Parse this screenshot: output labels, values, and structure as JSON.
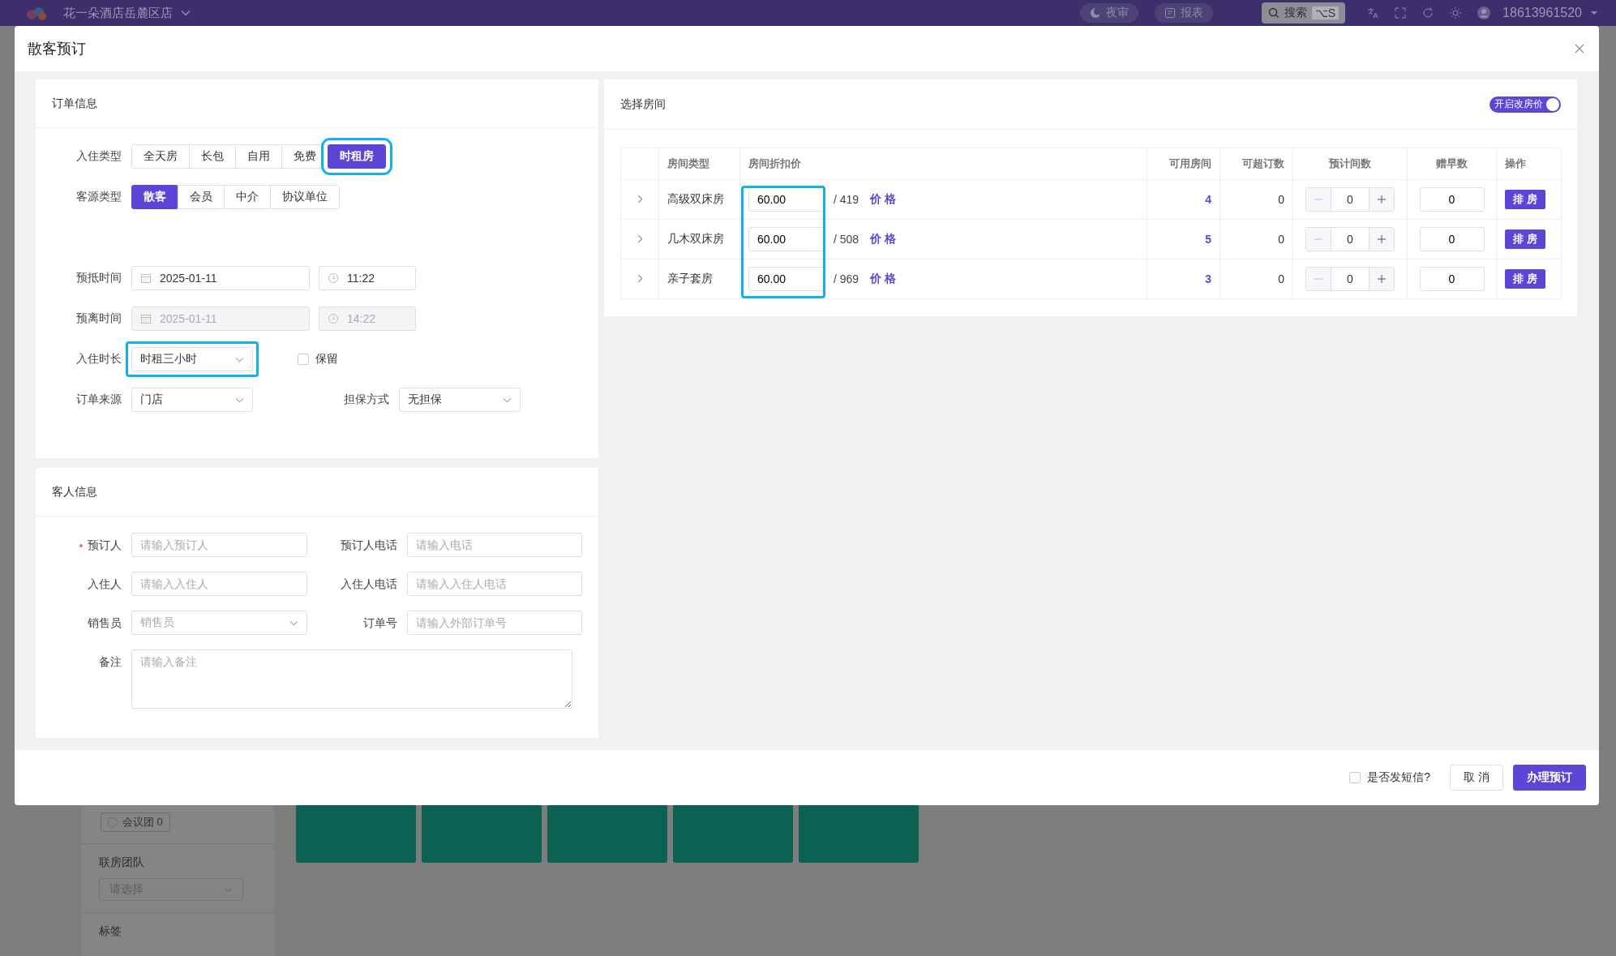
{
  "app_bar": {
    "hotel": "花一朵酒店岳麓区店",
    "buttons": [
      {
        "label": "夜审",
        "kind": "moon"
      },
      {
        "label": "报表",
        "kind": "report"
      }
    ],
    "search": {
      "label": "搜索",
      "shortcut": "⌥S"
    },
    "user": "18613961520"
  },
  "dialog": {
    "title": "散客预订"
  },
  "order_info": {
    "title": "订单信息",
    "checkin_type": {
      "label": "入住类型",
      "options": [
        {
          "label": "全天房",
          "selected": false,
          "highlighted": false
        },
        {
          "label": "长包",
          "selected": false,
          "highlighted": false
        },
        {
          "label": "自用",
          "selected": false,
          "highlighted": false
        },
        {
          "label": "免费",
          "selected": false,
          "highlighted": false
        },
        {
          "label": "时租房",
          "selected": true,
          "highlighted": true
        }
      ]
    },
    "guest_source": {
      "label": "客源类型",
      "options": [
        {
          "label": "散客",
          "selected": true,
          "highlighted": false
        },
        {
          "label": "会员",
          "selected": false,
          "highlighted": false
        },
        {
          "label": "中介",
          "selected": false,
          "highlighted": false
        },
        {
          "label": "协议单位",
          "selected": false,
          "highlighted": false
        }
      ]
    },
    "arrival": {
      "label": "预抵时间",
      "date": "2025-01-11",
      "time": "11:22",
      "disabled": false
    },
    "departure": {
      "label": "预离时间",
      "date": "2025-01-11",
      "time": "14:22",
      "disabled": true
    },
    "duration": {
      "label": "入住时长",
      "value": "时租三小时",
      "highlighted": true
    },
    "keep": {
      "label": "保留",
      "checked": false
    },
    "order_source": {
      "label": "订单来源",
      "value": "门店"
    },
    "guarantee": {
      "label": "担保方式",
      "value": "无担保"
    }
  },
  "guest_info": {
    "title": "客人信息",
    "fields": [
      {
        "label": "预订人",
        "placeholder": "请输入预订人",
        "required": true,
        "kind": "input"
      },
      {
        "label": "预订人电话",
        "placeholder": "请输入电话",
        "required": false,
        "kind": "input"
      },
      {
        "label": "入住人",
        "placeholder": "请输入入住人",
        "required": false,
        "kind": "input"
      },
      {
        "label": "入住人电话",
        "placeholder": "请输入入住人电话",
        "required": false,
        "kind": "input"
      },
      {
        "label": "销售员",
        "placeholder": "销售员",
        "required": false,
        "kind": "select"
      },
      {
        "label": "订单号",
        "placeholder": "请输入外部订单号",
        "required": false,
        "kind": "input"
      },
      {
        "label": "备注",
        "placeholder": "请输入备注",
        "required": false,
        "kind": "textarea"
      }
    ]
  },
  "rooms": {
    "title": "选择房间",
    "price_toggle": {
      "label": "开启改房价",
      "on": true
    },
    "price_highlighted": true,
    "columns": [
      "房间类型",
      "房间折扣价",
      "可用房间",
      "可超订数",
      "预计间数",
      "赠早数",
      "操作"
    ],
    "rows": [
      {
        "type": "高级双床房",
        "price": "60.00",
        "list_price": "/ 419",
        "link": "价 格",
        "available": "4",
        "overbook": "0",
        "count": "0",
        "breakfast": "0",
        "action": "排 房"
      },
      {
        "type": "几木双床房",
        "price": "60.00",
        "list_price": "/ 508",
        "link": "价 格",
        "available": "5",
        "overbook": "0",
        "count": "0",
        "breakfast": "0",
        "action": "排 房"
      },
      {
        "type": "亲子套房",
        "price": "60.00",
        "list_price": "/ 969",
        "link": "价 格",
        "available": "3",
        "overbook": "0",
        "count": "0",
        "breakfast": "0",
        "action": "排 房"
      }
    ]
  },
  "footer": {
    "sms": {
      "label": "是否发短信?",
      "checked": false
    },
    "buttons": [
      {
        "label": "取 消",
        "kind": "secondary"
      },
      {
        "label": "办理预订",
        "kind": "primary"
      }
    ]
  },
  "background": {
    "chip": "会议团 0",
    "group_label": "联房团队",
    "group_placeholder": "请选择",
    "tags_label": "标签"
  }
}
